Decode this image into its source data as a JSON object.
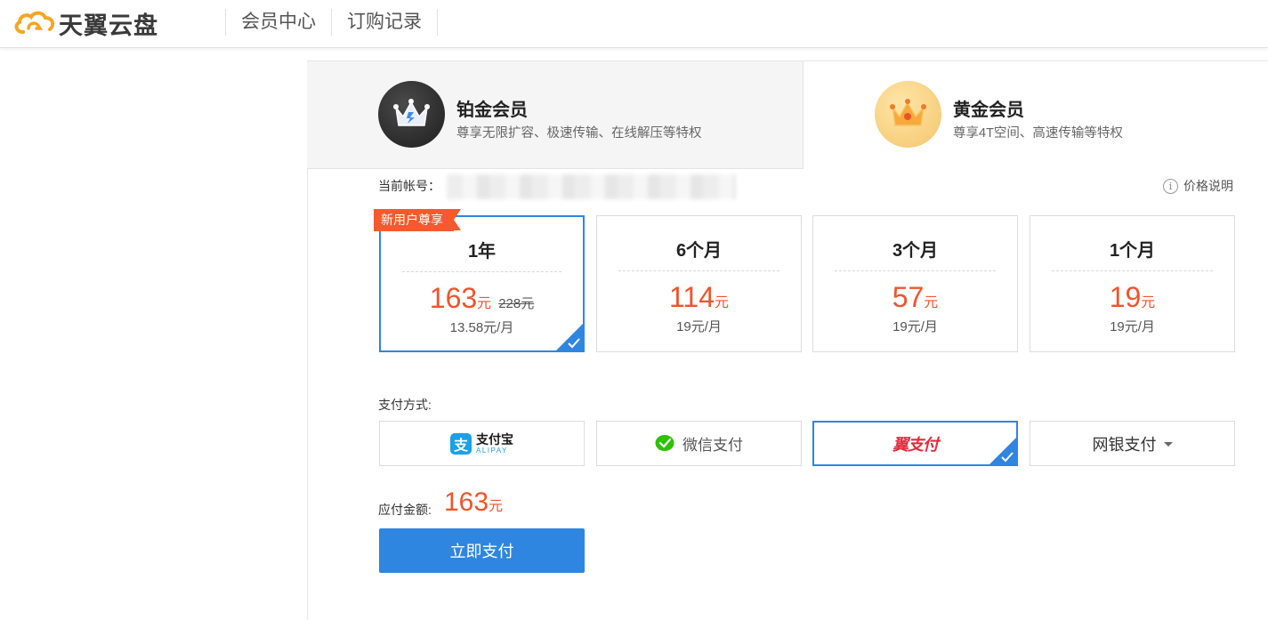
{
  "header": {
    "logo_text": "天翼云盘",
    "nav": [
      {
        "label": "会员中心"
      },
      {
        "label": "订购记录"
      }
    ]
  },
  "tiers": [
    {
      "name": "铂金会员",
      "desc": "尊享无限扩容、极速传输、在线解压等特权",
      "icon": "platinum-crown-icon",
      "selected": true
    },
    {
      "name": "黄金会员",
      "desc": "尊享4T空间、高速传输等特权",
      "icon": "gold-crown-icon",
      "selected": false
    }
  ],
  "account": {
    "label": "当前帐号：",
    "price_info": "价格说明",
    "info_glyph": "i"
  },
  "plans": [
    {
      "title": "1年",
      "price": "163",
      "unit": "元",
      "old_price": "228元",
      "monthly": "13.58元/月",
      "tag": "新用户尊享",
      "selected": true
    },
    {
      "title": "6个月",
      "price": "114",
      "unit": "元",
      "monthly": "19元/月",
      "selected": false
    },
    {
      "title": "3个月",
      "price": "57",
      "unit": "元",
      "monthly": "19元/月",
      "selected": false
    },
    {
      "title": "1个月",
      "price": "19",
      "unit": "元",
      "monthly": "19元/月",
      "selected": false
    }
  ],
  "payment": {
    "label": "支付方式:",
    "alipay": {
      "mark": "支",
      "cn": "支付宝",
      "en": "ALIPAY"
    },
    "wechat": {
      "label": "微信支付"
    },
    "tianyi": {
      "label": "翼支付",
      "selected": true
    },
    "netbank": {
      "label": "网银支付"
    }
  },
  "amount": {
    "label": "应付金额:",
    "value": "163",
    "unit": "元"
  },
  "pay_button": "立即支付",
  "colors": {
    "accent": "#2f86e0",
    "price": "#f0542c",
    "tag": "#f55a2c"
  }
}
